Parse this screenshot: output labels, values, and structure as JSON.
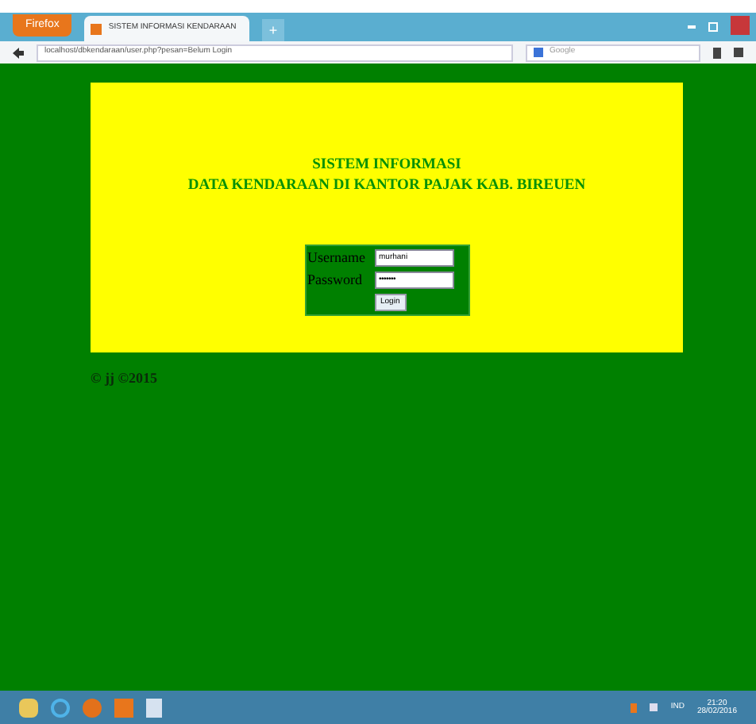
{
  "browser": {
    "menu_button": "Firefox",
    "tab": {
      "title": "SISTEM INFORMASI KENDARAAN",
      "selected": true
    },
    "new_tab": "+",
    "url": "localhost/dbkendaraan/user.php?pesan=Belum Login",
    "search_placeholder": "Google"
  },
  "page": {
    "title_lines": [
      "SISTEM INFORMASI",
      "DATA KENDARAAN DI KANTOR PAJAK KAB. BIREUEN"
    ],
    "form": {
      "fields": [
        {
          "label": "Username",
          "value": "murhani",
          "kind": "text"
        },
        {
          "label": "Password",
          "value": "•••••••",
          "kind": "password"
        }
      ],
      "submit": "Login"
    },
    "footer": "© jj ©2015"
  },
  "taskbar": {
    "language": "IND",
    "time": "21:20",
    "date": "28/02/2016"
  }
}
